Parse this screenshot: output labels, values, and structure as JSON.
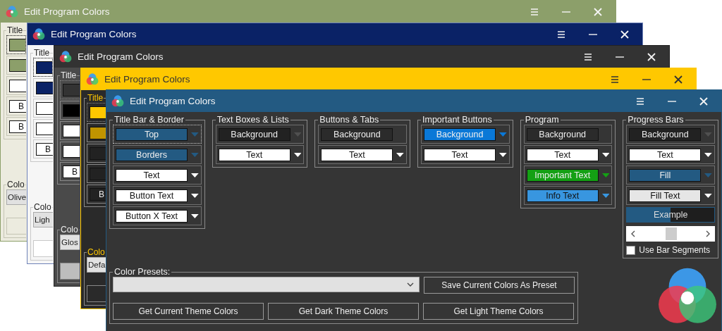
{
  "windows": [
    {
      "kind": "olive",
      "title": "Edit Program Colors",
      "title_group": {
        "label": "Title",
        "rows": [
          {
            "color": "#8c9f6a",
            "focused": true
          },
          {
            "color": "#8c9f6a",
            "focused": false
          },
          {
            "color": "#ffffff",
            "focused": false
          },
          {
            "color": "#ffffff",
            "label": "B",
            "focused": false
          },
          {
            "color": "#ffffff",
            "label": "B",
            "focused": false
          }
        ]
      },
      "presets": {
        "label": "Colo",
        "value": "Olive"
      }
    },
    {
      "kind": "navy",
      "title": "Edit Program Colors",
      "title_group": {
        "label": "Title",
        "rows": [
          {
            "color": "#0a2266",
            "focused": true
          },
          {
            "color": "#0a2266",
            "focused": false
          },
          {
            "color": "#ffffff",
            "focused": false
          },
          {
            "color": "#ffffff",
            "focused": false
          },
          {
            "color": "#ffffff",
            "label": "B",
            "focused": false
          }
        ]
      },
      "presets": {
        "label": "Colo",
        "value": "Ligh"
      }
    },
    {
      "kind": "dark",
      "title": "Edit Program Colors",
      "title_group": {
        "label": "Title",
        "rows": [
          {
            "color": "#333333",
            "focused": true
          },
          {
            "color": "#000000",
            "focused": false
          },
          {
            "color": "#ffffff",
            "focused": false
          },
          {
            "color": "#ffffff",
            "focused": false
          },
          {
            "color": "#ffffff",
            "label": "B",
            "focused": false
          }
        ]
      },
      "presets": {
        "label": "Colo",
        "value": "Glos"
      }
    },
    {
      "kind": "yellow",
      "title": "Edit Program Colors",
      "title_group": {
        "label": "Title",
        "rows": [
          {
            "color": "#ffc800",
            "focused": true
          },
          {
            "color": "#c09400",
            "focused": false
          },
          {
            "color": "#222222",
            "focused": false
          },
          {
            "color": "#222222",
            "focused": false
          },
          {
            "color": "#222222",
            "label": "B",
            "focused": false
          }
        ]
      },
      "presets": {
        "label": "Colo",
        "value": "Defa"
      }
    }
  ],
  "front": {
    "title": "Edit Program Colors",
    "groups": [
      {
        "label": "Title Bar & Border",
        "rows": [
          {
            "label": "Top",
            "color": "#235a82",
            "kind": "dropdown",
            "focused": true
          },
          {
            "label": "Borders",
            "color": "#235a82",
            "kind": "dropdown",
            "focused": false
          },
          {
            "label": "Text",
            "color": "#ffffff",
            "kind": "dropdown",
            "focused": false
          },
          {
            "label": "Button Text",
            "color": "#ffffff",
            "kind": "dropdown",
            "focused": false
          },
          {
            "label": "Button X Text",
            "color": "#ffffff",
            "kind": "dropdown",
            "focused": false
          }
        ]
      },
      {
        "label": "Text Boxes & Lists",
        "rows": [
          {
            "label": "Background",
            "color": "#222222",
            "kind": "dropdown",
            "focused": false
          },
          {
            "label": "Text",
            "color": "#ffffff",
            "kind": "dropdown",
            "focused": false
          }
        ]
      },
      {
        "label": "Buttons & Tabs",
        "rows": [
          {
            "label": "Background",
            "color": "#2b2b2b",
            "kind": "plain",
            "focused": false
          },
          {
            "label": "Text",
            "color": "#ffffff",
            "kind": "dropdown",
            "focused": false
          }
        ]
      },
      {
        "label": "Important Buttons",
        "rows": [
          {
            "label": "Background",
            "color": "#0a78d7",
            "kind": "dropdown",
            "focused": false
          },
          {
            "label": "Text",
            "color": "#ffffff",
            "kind": "dropdown",
            "focused": false
          }
        ]
      },
      {
        "label": "Program",
        "rows": [
          {
            "label": "Background",
            "color": "#2b2b2b",
            "kind": "plain",
            "focused": false
          },
          {
            "label": "Text",
            "color": "#ffffff",
            "kind": "dropdown",
            "focused": false
          },
          {
            "label": "Important Text",
            "color": "#14a014",
            "kind": "dropdown",
            "focused": false
          },
          {
            "label": "Info Text",
            "color": "#3896e0",
            "kind": "dropdown",
            "focused": false
          }
        ]
      },
      {
        "label": "Progress Bars",
        "rows": [
          {
            "label": "Background",
            "color": "#222222",
            "kind": "dropdown",
            "focused": false
          },
          {
            "label": "Text",
            "color": "#ffffff",
            "kind": "dropdown",
            "focused": false
          },
          {
            "label": "Fill",
            "color": "#235a82",
            "kind": "dropdown",
            "focused": false
          },
          {
            "label": "Fill Text",
            "color": "#e6e6e6",
            "kind": "dropdown",
            "focused": false
          }
        ],
        "example": {
          "label": "Example",
          "level": 0.5
        },
        "segments": {
          "label": "Use Bar Segments",
          "checked": false
        }
      }
    ],
    "presets": {
      "label": "Color Presets:",
      "save_button": "Save Current Colors As Preset",
      "buttons": [
        "Get Current Theme Colors",
        "Get Dark Theme Colors",
        "Get Light Theme Colors"
      ]
    }
  }
}
